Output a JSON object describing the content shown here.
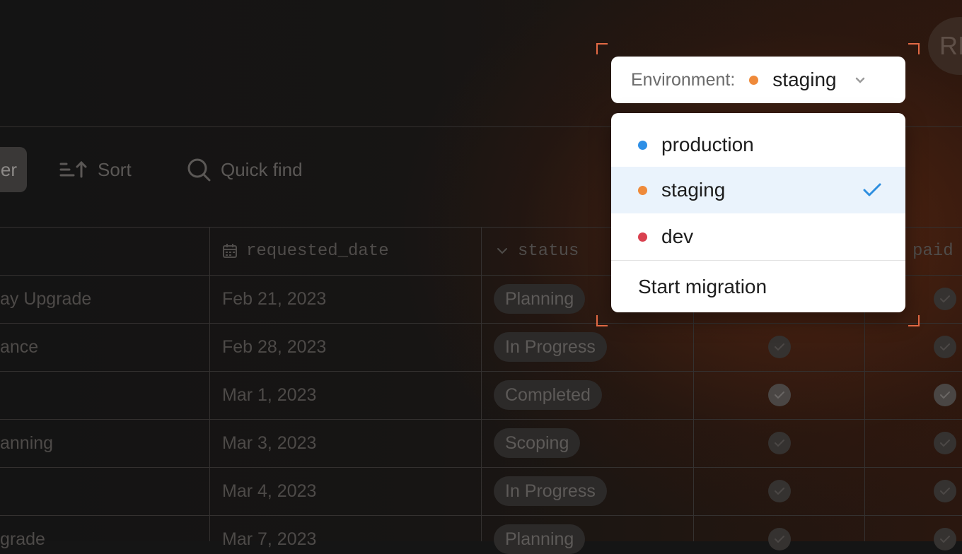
{
  "avatar": {
    "initials": "RI"
  },
  "toolbar": {
    "filter_label": "er",
    "sort_label": "Sort",
    "quick_find_placeholder": "Quick find"
  },
  "table": {
    "columns": [
      "requested_date",
      "status",
      "paid"
    ],
    "rows": [
      {
        "name": "ay Upgrade",
        "requested_date": "Feb 21, 2023",
        "status": "Planning",
        "checks": [
          false,
          false
        ]
      },
      {
        "name": "ance",
        "requested_date": "Feb 28, 2023",
        "status": "In Progress",
        "checks": [
          false,
          false
        ]
      },
      {
        "name": "",
        "requested_date": "Mar 1, 2023",
        "status": "Completed",
        "checks": [
          true,
          true
        ]
      },
      {
        "name": "anning",
        "requested_date": "Mar 3, 2023",
        "status": "Scoping",
        "checks": [
          false,
          false
        ]
      },
      {
        "name": "",
        "requested_date": "Mar 4, 2023",
        "status": "In Progress",
        "checks": [
          false,
          false
        ]
      },
      {
        "name": "grade",
        "requested_date": "Mar 7, 2023",
        "status": "Planning",
        "checks": [
          false,
          false
        ]
      }
    ]
  },
  "environment": {
    "label": "Environment:",
    "selected": "staging",
    "selected_color": "#ef8a3a",
    "options": [
      {
        "label": "production",
        "color": "#2e8fe6",
        "selected": false
      },
      {
        "label": "staging",
        "color": "#ef8a3a",
        "selected": true
      },
      {
        "label": "dev",
        "color": "#d9414f",
        "selected": false
      }
    ],
    "action_label": "Start migration",
    "check_color": "#2f8fdf"
  }
}
